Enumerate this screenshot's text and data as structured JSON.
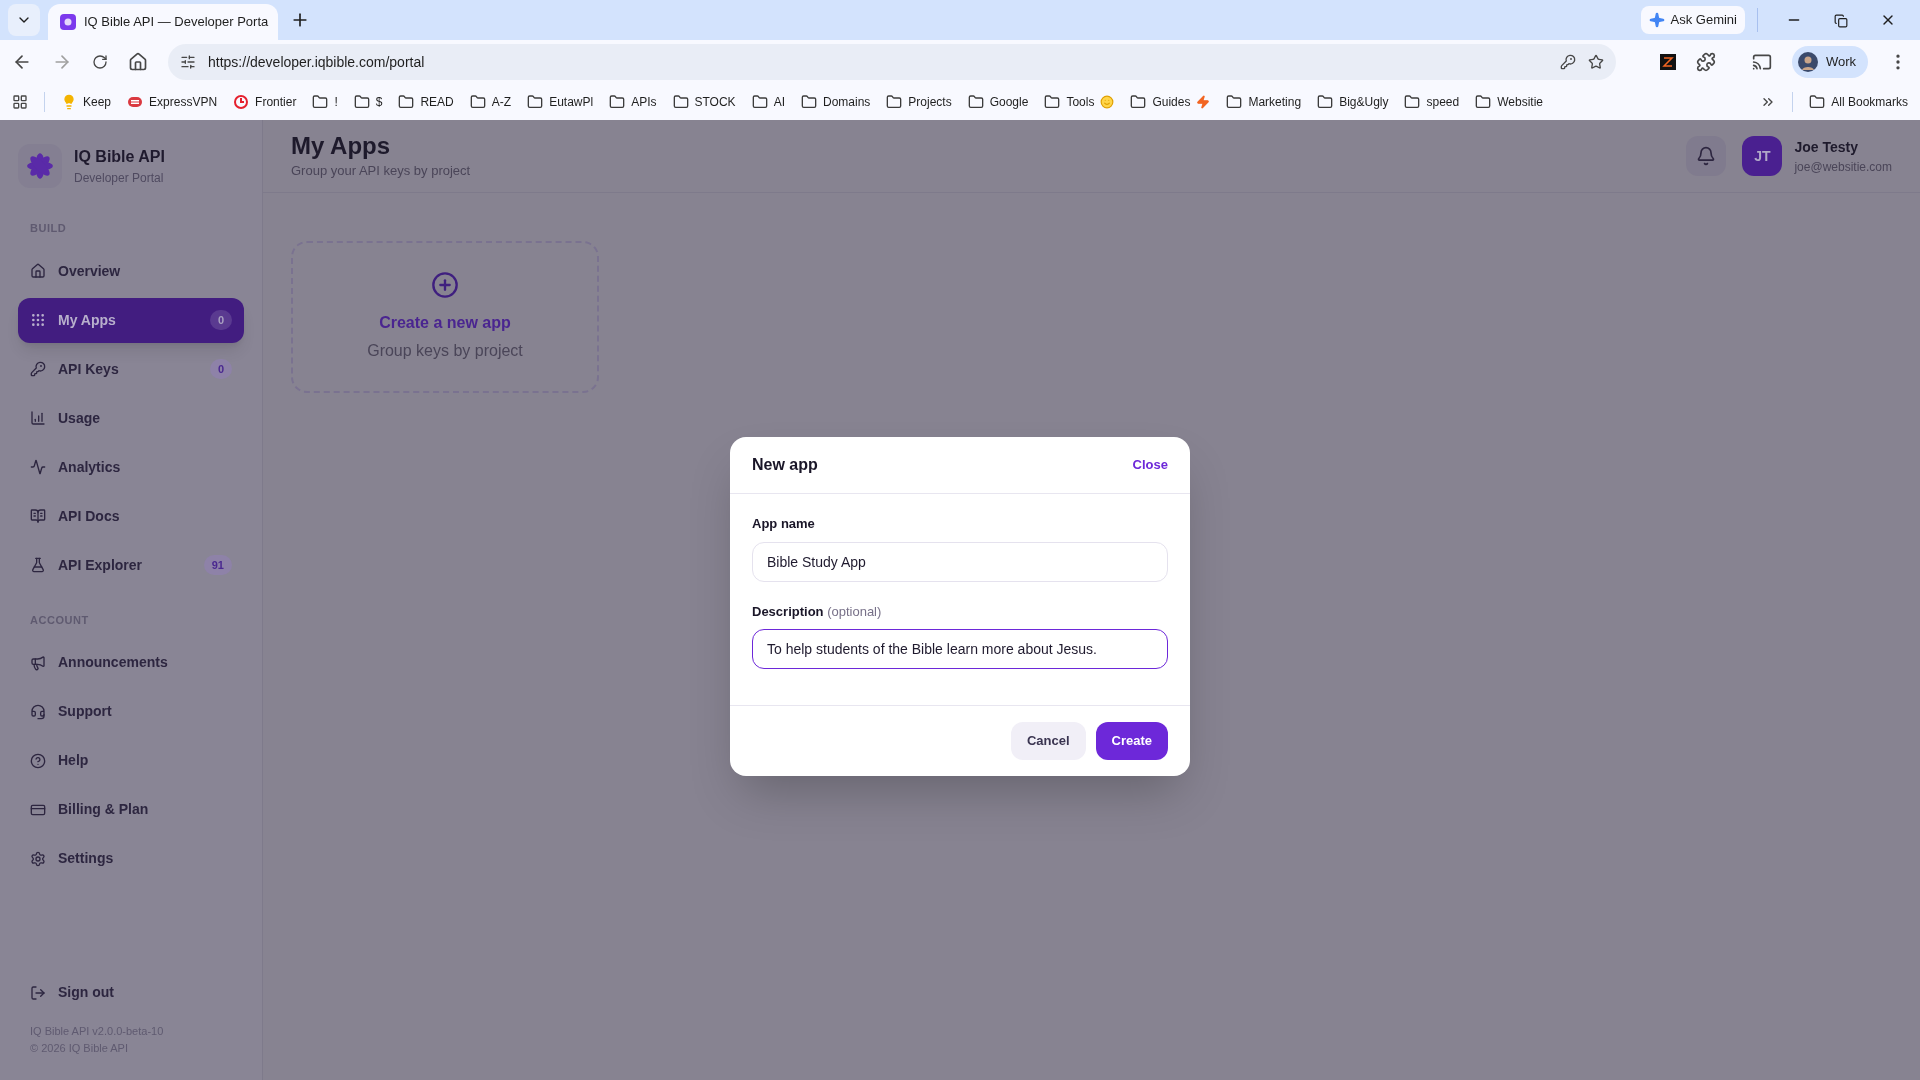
{
  "browser": {
    "tabs": [
      {
        "title": "IQ Bible API — Developer Porta",
        "selected": true
      }
    ],
    "ask_gemini": "Ask Gemini",
    "address": "https://developer.iqbible.com/portal",
    "profile": "Work",
    "bookmarks": [
      {
        "label": "Keep",
        "kind": "keep"
      },
      {
        "label": "ExpressVPN",
        "kind": "vpn"
      },
      {
        "label": "Frontier",
        "kind": "frontier"
      },
      {
        "label": "!",
        "kind": "folder"
      },
      {
        "label": "$",
        "kind": "folder"
      },
      {
        "label": "READ",
        "kind": "folder"
      },
      {
        "label": "A-Z",
        "kind": "folder"
      },
      {
        "label": "EutawPl",
        "kind": "folder"
      },
      {
        "label": "APIs",
        "kind": "folder"
      },
      {
        "label": "STOCK",
        "kind": "folder"
      },
      {
        "label": "AI",
        "kind": "folder"
      },
      {
        "label": "Domains",
        "kind": "folder"
      },
      {
        "label": "Projects",
        "kind": "folder"
      },
      {
        "label": "Google",
        "kind": "folder"
      },
      {
        "label": "Tools",
        "kind": "smiley"
      },
      {
        "label": "Guides",
        "kind": "bolt"
      },
      {
        "label": "Marketing",
        "kind": "folder"
      },
      {
        "label": "Big&Ugly",
        "kind": "folder"
      },
      {
        "label": "speed",
        "kind": "folder"
      },
      {
        "label": "Websitie",
        "kind": "folder"
      }
    ],
    "all_bookmarks": "All Bookmarks"
  },
  "sidebar": {
    "brand": {
      "title": "IQ Bible API",
      "subtitle": "Developer Portal"
    },
    "sections": [
      {
        "heading": "BUILD",
        "items": [
          {
            "label": "Overview",
            "selected": false
          },
          {
            "label": "My Apps",
            "selected": true,
            "badge": "0"
          },
          {
            "label": "API Keys",
            "selected": false,
            "badge": "0"
          },
          {
            "label": "Usage",
            "selected": false
          },
          {
            "label": "Analytics",
            "selected": false
          },
          {
            "label": "API Docs",
            "selected": false
          },
          {
            "label": "API Explorer",
            "selected": false,
            "badge": "91"
          }
        ]
      },
      {
        "heading": "ACCOUNT",
        "items": [
          {
            "label": "Announcements",
            "selected": false
          },
          {
            "label": "Support",
            "selected": false
          },
          {
            "label": "Help",
            "selected": false
          },
          {
            "label": "Billing & Plan",
            "selected": false
          },
          {
            "label": "Settings",
            "selected": false
          }
        ]
      }
    ],
    "sign_out": "Sign out",
    "version": "IQ Bible API v2.0.0-beta-10",
    "copyright": "© 2026 IQ Bible API"
  },
  "header": {
    "title": "My Apps",
    "subtitle": "Group your API keys by project",
    "user": {
      "initials": "JT",
      "name": "Joe Testy",
      "email": "joe@websitie.com"
    }
  },
  "new_app_card": {
    "title": "Create a new app",
    "subtitle": "Group keys by project"
  },
  "dialog": {
    "title": "New app",
    "close": "Close",
    "fields": [
      {
        "label": "App name",
        "value": "Bible Study App",
        "focused": false
      },
      {
        "label": "Description",
        "hint": "(optional)",
        "value": "To help students of the Bible learn more about Jesus.",
        "focused": true
      }
    ],
    "buttons": [
      {
        "label": "Cancel",
        "kind": "secondary"
      },
      {
        "label": "Create",
        "kind": "primary"
      }
    ]
  }
}
